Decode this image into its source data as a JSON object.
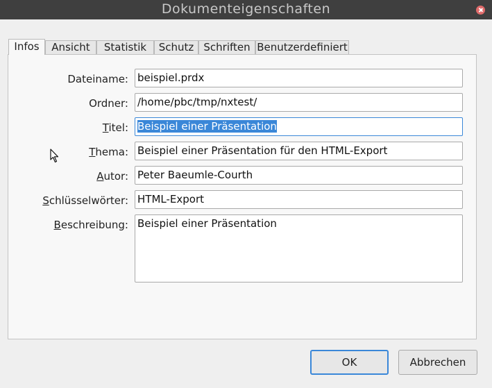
{
  "window": {
    "title": "Dokumenteigenschaften"
  },
  "tabs": [
    {
      "label": "Infos",
      "active": true
    },
    {
      "label": "Ansicht"
    },
    {
      "label": "Statistik"
    },
    {
      "label": "Schutz"
    },
    {
      "label": "Schriften"
    },
    {
      "label": "Benutzerdefiniert"
    }
  ],
  "form": {
    "dateiname": {
      "label": "Dateiname:",
      "value": "beispiel.prdx"
    },
    "ordner": {
      "label": "Ordner:",
      "value": "/home/pbc/tmp/nxtest/"
    },
    "titel": {
      "label_underlined": "T",
      "label_rest": "itel:",
      "value": "Beispiel einer Präsentation"
    },
    "thema": {
      "label_underlined": "T",
      "label_rest": "hema:",
      "value": "Beispiel einer Präsentation für den HTML-Export"
    },
    "autor": {
      "label_underlined": "A",
      "label_rest": "utor:",
      "value": "Peter Baeumle-Courth"
    },
    "schluesselwoerter": {
      "label_underlined": "S",
      "label_rest": "chlüsselwörter:",
      "value": "HTML-Export"
    },
    "beschreibung": {
      "label_underlined": "B",
      "label_rest": "eschreibung:",
      "value": "Beispiel einer Präsentation"
    }
  },
  "buttons": {
    "ok": "OK",
    "cancel": "Abbrechen"
  },
  "colors": {
    "accent": "#3a87d8",
    "titlebar": "#3f3f3f",
    "close": "#e06b6b"
  }
}
